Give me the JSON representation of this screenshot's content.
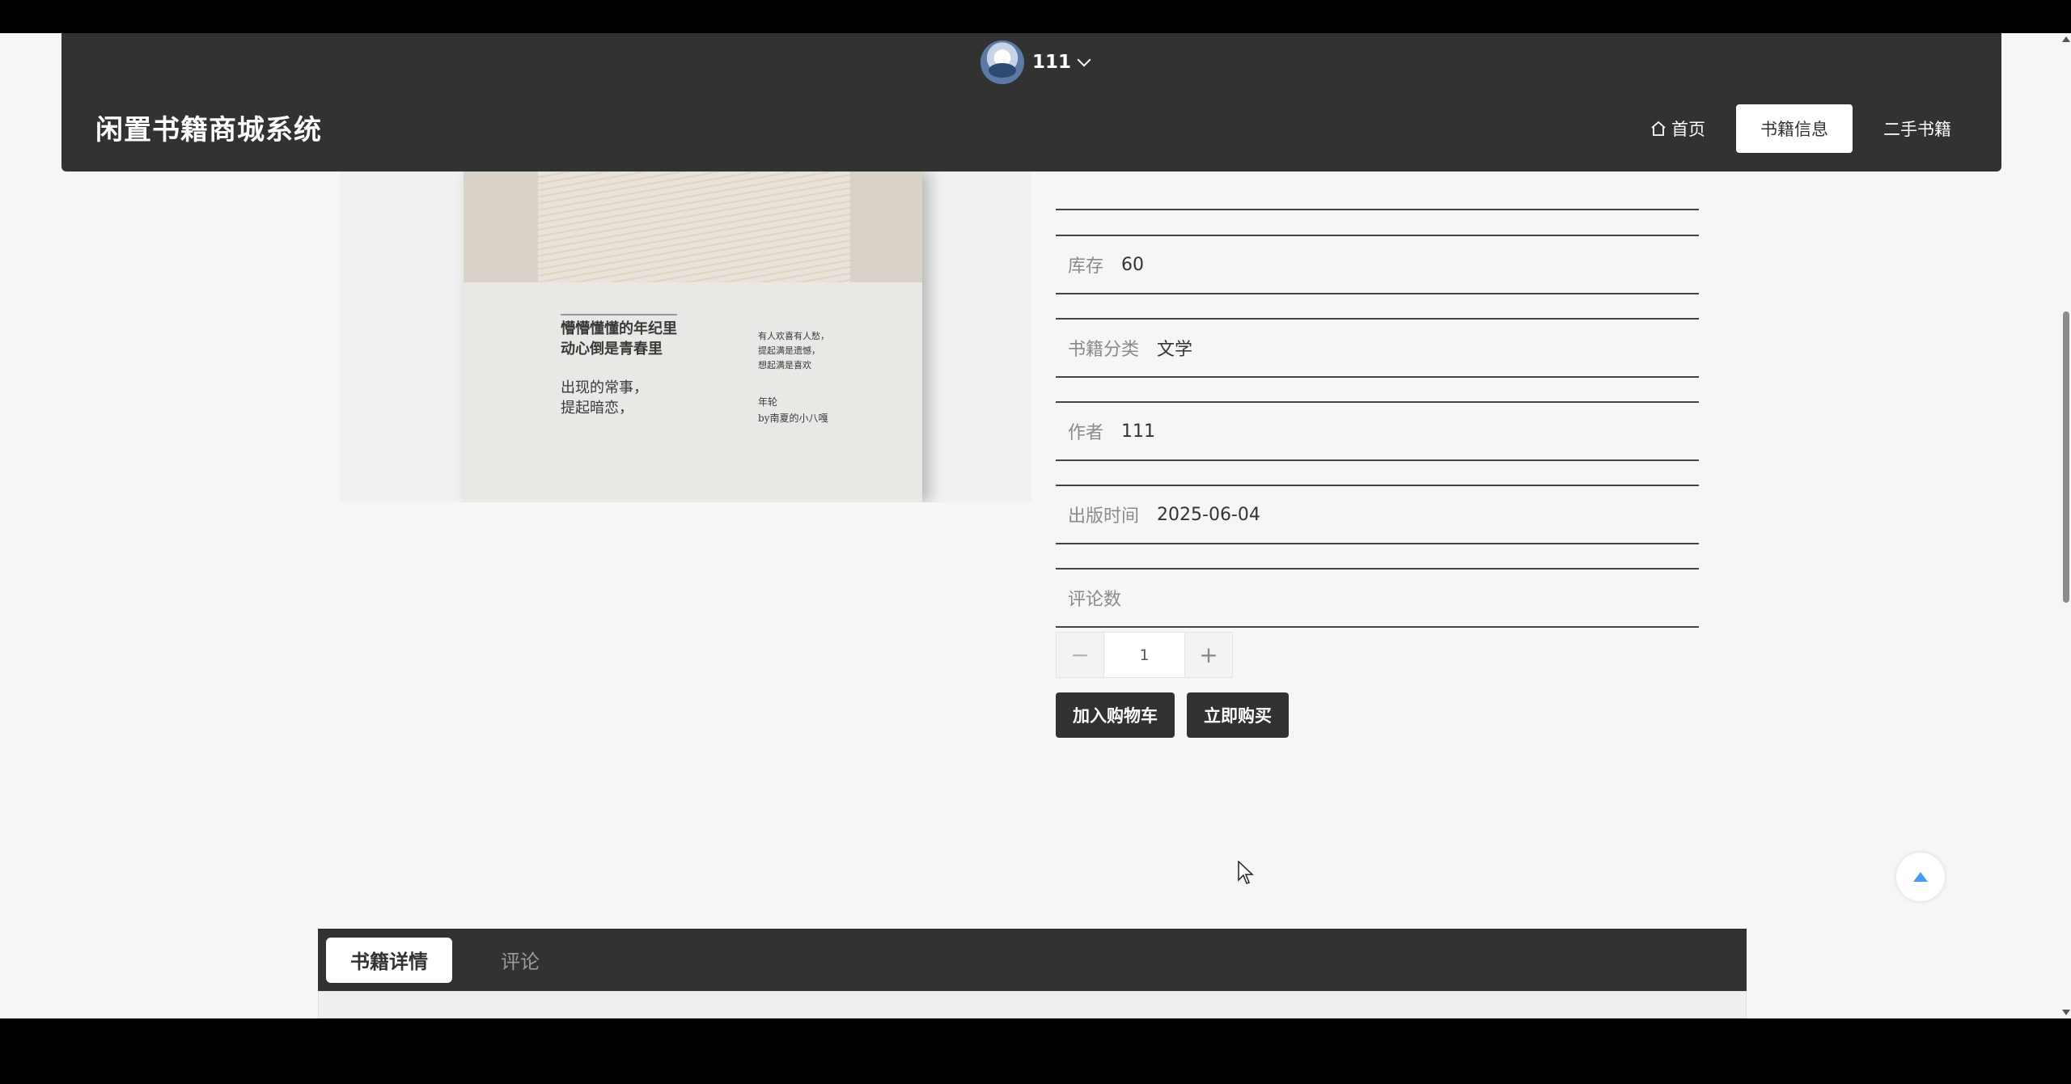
{
  "header": {
    "user_name": "111",
    "site_title": "闲置书籍商城系统",
    "nav": [
      {
        "label": "首页"
      },
      {
        "label": "书籍信息"
      },
      {
        "label": "二手书籍"
      }
    ]
  },
  "cover": {
    "line1": "懵懵懂懂的年纪里",
    "line2": "动心倒是青春里",
    "line3": "出现的常事，",
    "line4": "提起暗恋，",
    "small1": "有人欢喜有人愁，",
    "small2": "提起满是遗憾，",
    "small3": "想起满是喜欢",
    "author1": "年轮",
    "author2": "by南夏的小八嘎"
  },
  "info": {
    "stock_label": "库存",
    "stock_value": "60",
    "category_label": "书籍分类",
    "category_value": "文学",
    "author_label": "作者",
    "author_value": "111",
    "publish_label": "出版时间",
    "publish_value": "2025-06-04",
    "comments_label": "评论数",
    "comments_value": ""
  },
  "quantity": {
    "minus": "−",
    "value": "1",
    "plus": "+"
  },
  "actions": {
    "add_cart": "加入购物车",
    "buy_now": "立即购买"
  },
  "tabs": [
    {
      "label": "书籍详情"
    },
    {
      "label": "评论"
    }
  ],
  "colors": {
    "header_bg": "#333232",
    "page_bg": "#f6f6f6",
    "accent": "#409eff"
  }
}
